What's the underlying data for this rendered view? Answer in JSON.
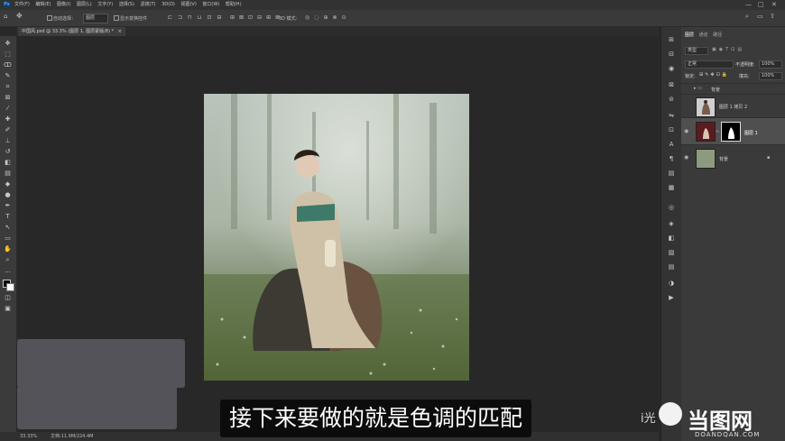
{
  "menu": {
    "logo": "Ps",
    "items": [
      "文件(F)",
      "编辑(E)",
      "图像(I)",
      "图层(L)",
      "文字(Y)",
      "选择(S)",
      "滤镜(T)",
      "3D(D)",
      "视图(V)",
      "窗口(W)",
      "帮助(H)"
    ],
    "minimize": "—",
    "maximize": "□",
    "close": "✕"
  },
  "options": {
    "auto_select": "自动选择：",
    "auto_select_target": "图层",
    "show_transform": "显示变换控件",
    "mode_3d": "3D 模式："
  },
  "document_tab": {
    "label": "中国风.psd @ 33.3% (图层 1, 图层蒙版/8) *",
    "close": "×"
  },
  "status": {
    "zoom": "33.33%",
    "doc_size": "文档:11.9M/224.4M"
  },
  "layers_panel": {
    "tabs": [
      "图层",
      "通道",
      "路径"
    ],
    "kind_filter": "类型",
    "blend_mode": "正常",
    "opacity_label": "不透明度:",
    "opacity_value": "100%",
    "lock_label": "锁定:",
    "fill_label": "填充:",
    "fill_value": "100%",
    "layers": [
      {
        "name": "背景",
        "kind": "group"
      },
      {
        "name": "图层 1 拷贝 2",
        "kind": "pixel"
      },
      {
        "name": "图层 1",
        "kind": "pixel-mask",
        "selected": true
      },
      {
        "name": "背景",
        "kind": "background",
        "locked": true
      }
    ]
  },
  "subtitle": "接下来要做的就是色调的匹配",
  "watermark": {
    "left_text": "i光",
    "brand": "当图网",
    "brand_url": "DOANDQAN.COM"
  },
  "colors": {
    "ui_bg": "#282828",
    "panel": "#3a3a3a",
    "selected_layer": "#4f4f4f",
    "subtitle_bg": "#0c0c0c"
  }
}
